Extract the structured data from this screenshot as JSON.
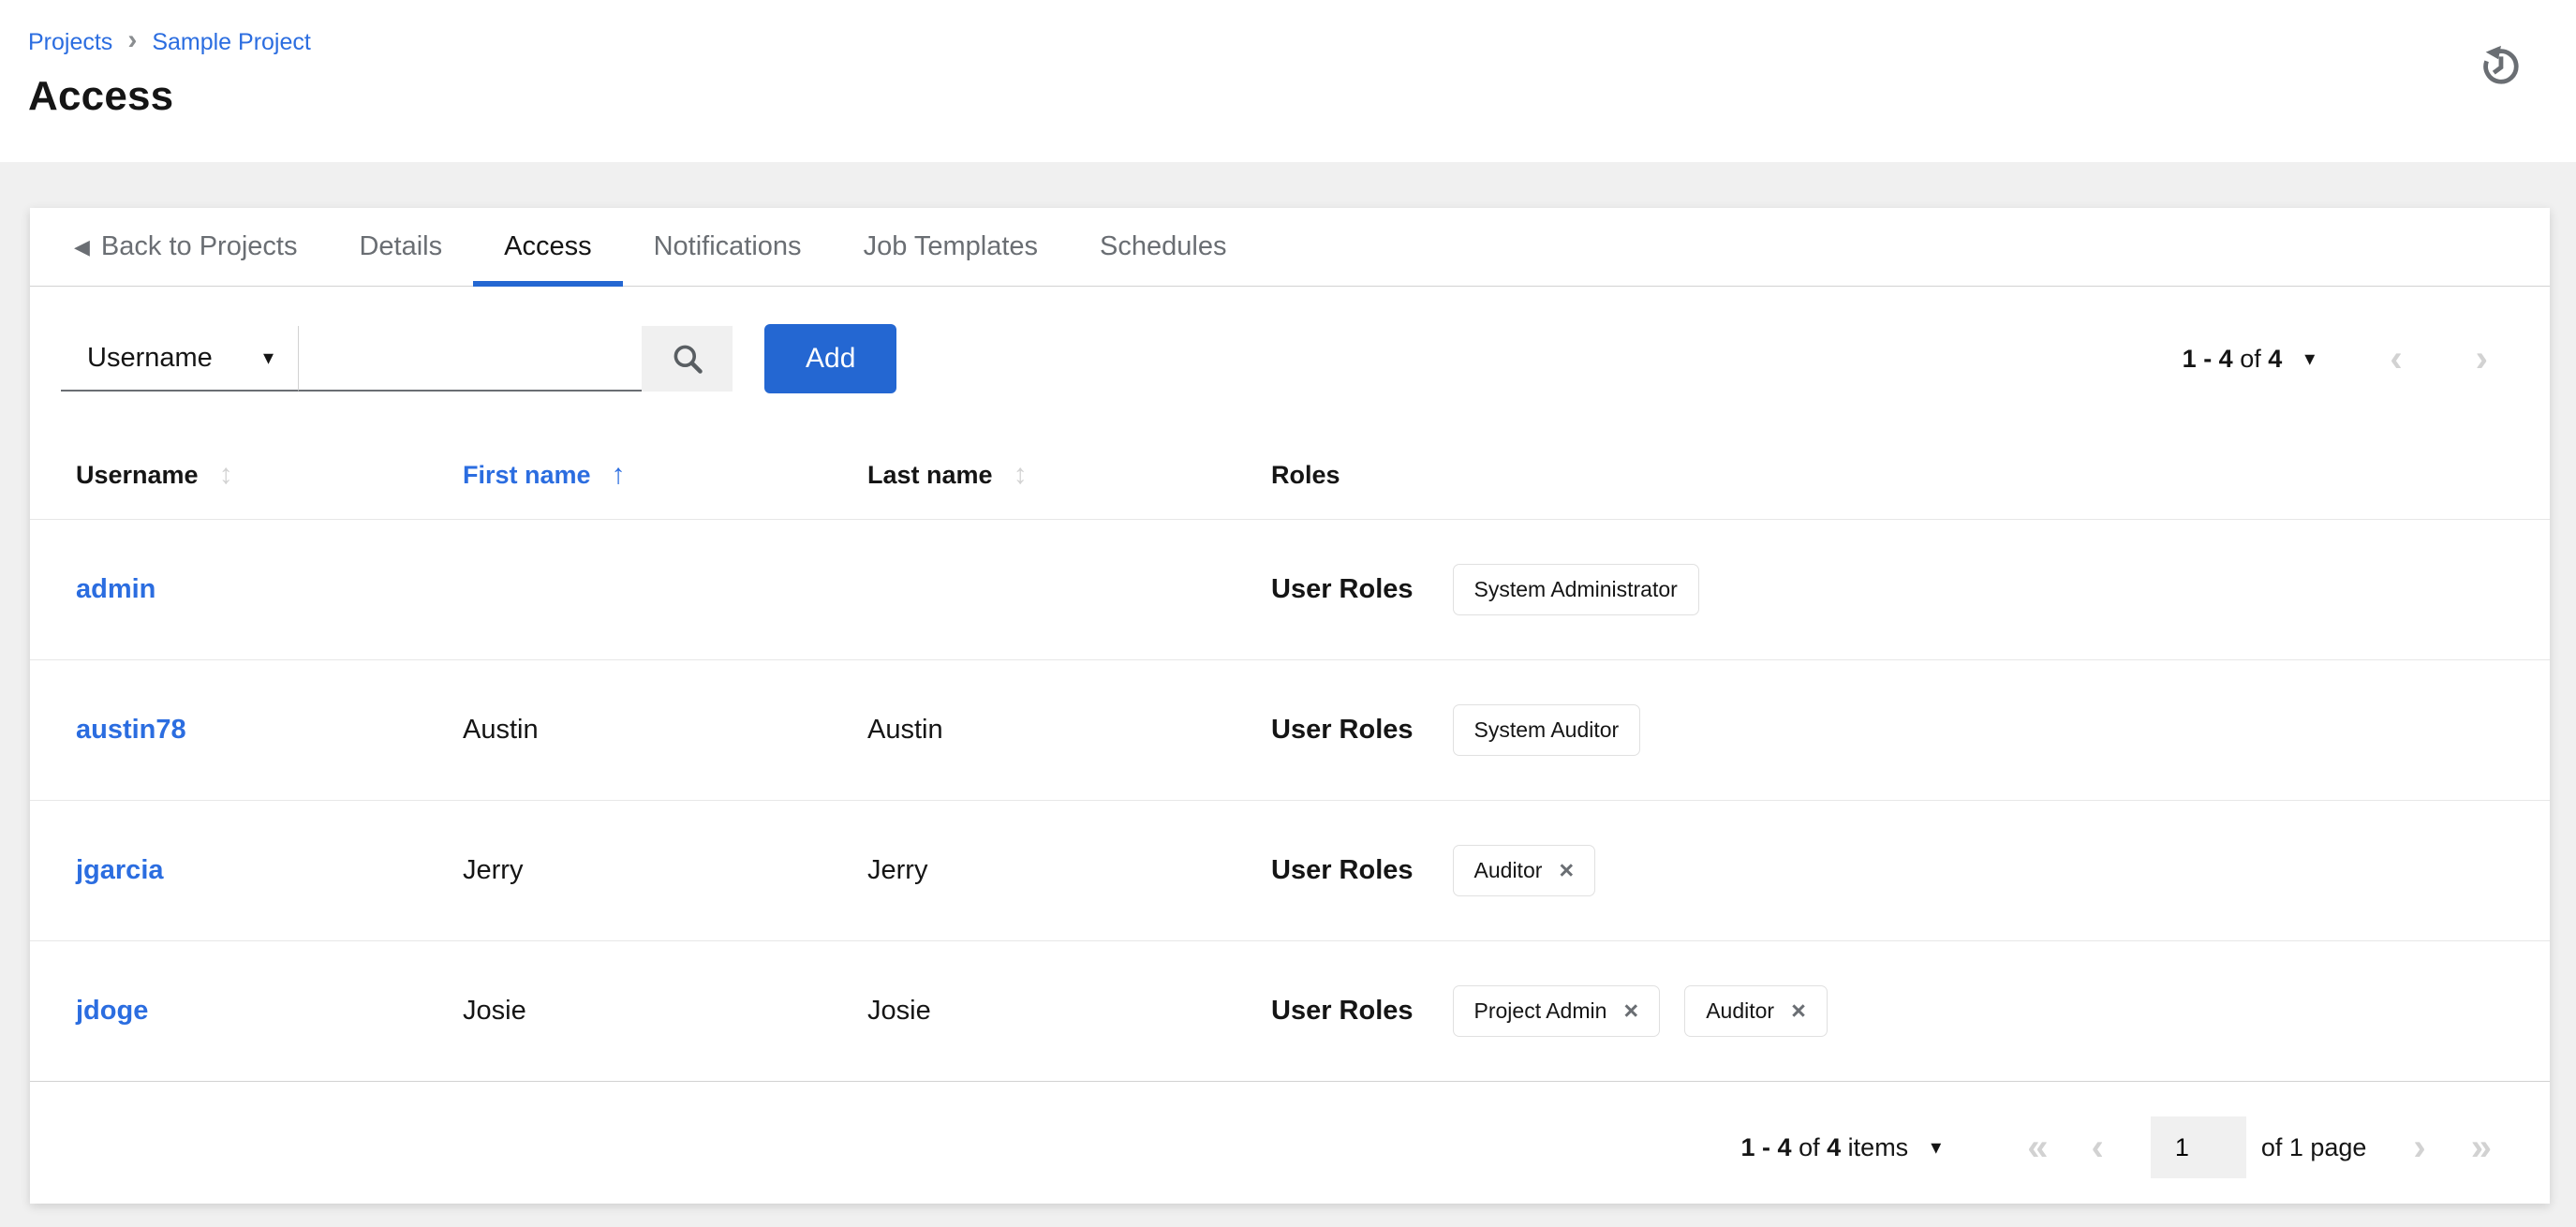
{
  "colors": {
    "accent": "#2467d2",
    "link": "#2b6de0",
    "page_bg": "#f0f0f0",
    "muted": "#6a6e73",
    "disabled": "#d2d2d2"
  },
  "breadcrumb": {
    "items": [
      "Projects",
      "Sample Project"
    ],
    "separator": "›"
  },
  "page_title": "Access",
  "icons": {
    "back": "◀",
    "caret_down": "▾",
    "sort_both": "↕",
    "sort_asc": "↑",
    "angle_left": "‹",
    "angle_right": "›",
    "angle_double_left": "«",
    "angle_double_right": "»",
    "close": "×"
  },
  "tabs": [
    {
      "label": "Back to Projects",
      "back": true,
      "active": false
    },
    {
      "label": "Details",
      "back": false,
      "active": false
    },
    {
      "label": "Access",
      "back": false,
      "active": true
    },
    {
      "label": "Notifications",
      "back": false,
      "active": false
    },
    {
      "label": "Job Templates",
      "back": false,
      "active": false
    },
    {
      "label": "Schedules",
      "back": false,
      "active": false
    }
  ],
  "toolbar": {
    "filter": {
      "selected": "Username"
    },
    "search": {
      "value": "",
      "placeholder": ""
    },
    "add_label": "Add",
    "pagination": {
      "range": "1 - 4",
      "of_word": "of",
      "total": "4"
    }
  },
  "table": {
    "columns": [
      {
        "label": "Username",
        "sort": "both"
      },
      {
        "label": "First name",
        "sort": "asc"
      },
      {
        "label": "Last name",
        "sort": "both"
      },
      {
        "label": "Roles",
        "sort": "none"
      }
    ],
    "roles_label": "User Roles",
    "rows": [
      {
        "username": "admin",
        "first_name": "",
        "last_name": "",
        "roles": [
          {
            "name": "System Administrator",
            "removable": false
          }
        ]
      },
      {
        "username": "austin78",
        "first_name": "Austin",
        "last_name": "Austin",
        "roles": [
          {
            "name": "System Auditor",
            "removable": false
          }
        ]
      },
      {
        "username": "jgarcia",
        "first_name": "Jerry",
        "last_name": "Jerry",
        "roles": [
          {
            "name": "Auditor",
            "removable": true
          }
        ]
      },
      {
        "username": "jdoge",
        "first_name": "Josie",
        "last_name": "Josie",
        "roles": [
          {
            "name": "Project Admin",
            "removable": true
          },
          {
            "name": "Auditor",
            "removable": true
          }
        ]
      }
    ]
  },
  "footer": {
    "pagination": {
      "range": "1 - 4",
      "of_word": "of",
      "total": "4",
      "items_word": "items",
      "page_value": "1",
      "page_of_label": "of 1 page"
    }
  }
}
